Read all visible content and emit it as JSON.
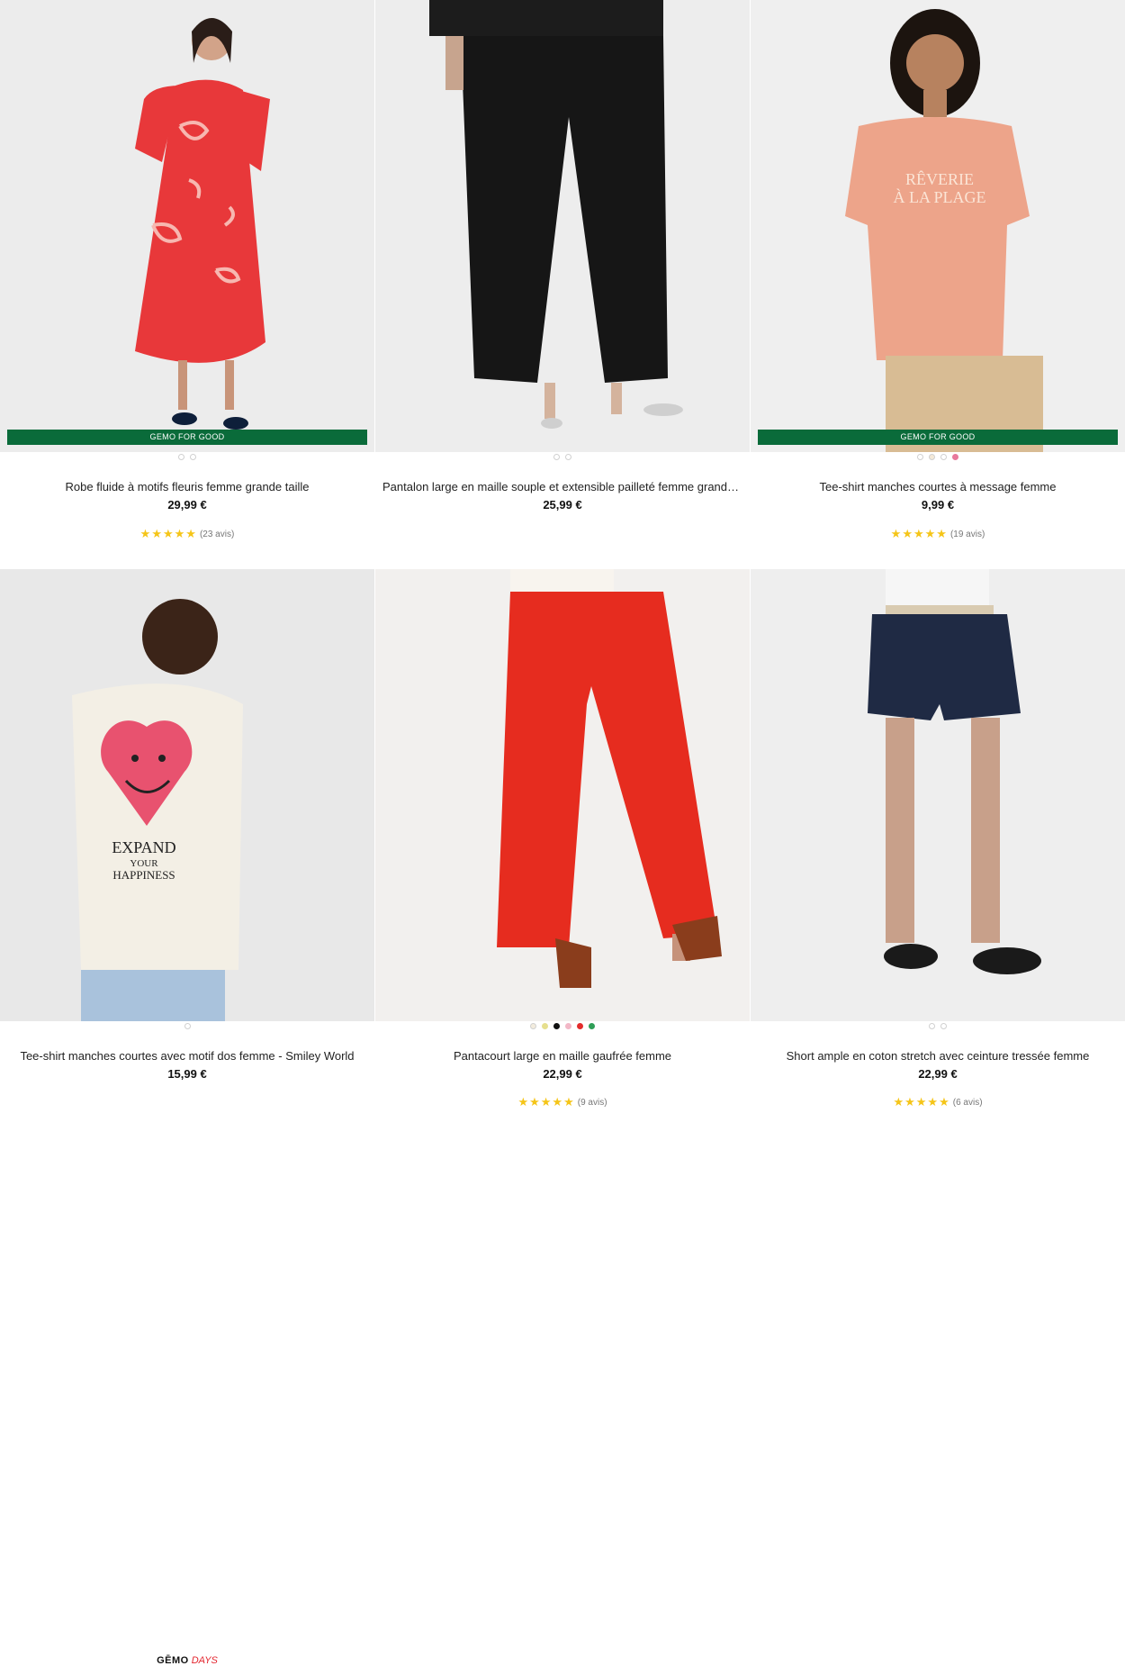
{
  "products": [
    {
      "title": "Robe fluide à motifs fleuris femme grande taille",
      "price": "29,99 €",
      "badge": "GEMO FOR GOOD",
      "stars": "★★★★★",
      "reviews": "(23 avis)",
      "swatches": [
        "#ffffff",
        "#ffffff"
      ]
    },
    {
      "title": "Pantalon large en maille souple et extensible pailleté femme grande taille",
      "price": "25,99 €",
      "swatches": [
        "#ffffff",
        "#ffffff"
      ]
    },
    {
      "title": "Tee-shirt manches courtes à message femme",
      "price": "9,99 €",
      "badge": "GEMO FOR GOOD",
      "stars": "★★★★★",
      "reviews": "(19 avis)",
      "swatches": [
        "#ffffff",
        "#f3e9d8",
        "#ffffff",
        "#e8799c"
      ]
    },
    {
      "title": "Tee-shirt manches courtes avec motif dos femme - Smiley World",
      "price": "15,99 €",
      "promo_brand": "GĒMO",
      "promo_label": "DAYS",
      "swatches": [
        "#ffffff"
      ]
    },
    {
      "title": "Pantacourt large en maille gaufrée femme",
      "price": "22,99 €",
      "stars": "★★★★★",
      "reviews": "(9 avis)",
      "swatches": [
        "#f3ecdd",
        "#e6df8e",
        "#111111",
        "#f2b7c6",
        "#e32c2c",
        "#2f9e57"
      ]
    },
    {
      "title": "Short ample en coton stretch avec ceinture tressée femme",
      "price": "22,99 €",
      "stars": "★★★★★",
      "reviews": "(6 avis)",
      "swatches": [
        "#ffffff",
        "#ffffff"
      ]
    }
  ]
}
